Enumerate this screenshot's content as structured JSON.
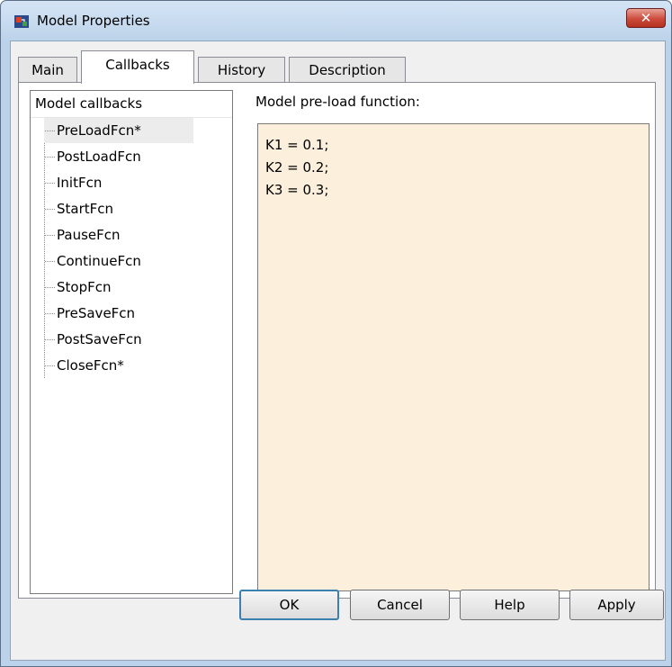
{
  "window": {
    "title": "Model Properties",
    "close_glyph": "✕"
  },
  "tabs": [
    {
      "label": "Main",
      "active": false
    },
    {
      "label": "Callbacks",
      "active": true
    },
    {
      "label": "History",
      "active": false
    },
    {
      "label": "Description",
      "active": false
    }
  ],
  "callbacks": {
    "header": "Model callbacks",
    "items": [
      "PreLoadFcn*",
      "PostLoadFcn",
      "InitFcn",
      "StartFcn",
      "PauseFcn",
      "ContinueFcn",
      "StopFcn",
      "PreSaveFcn",
      "PostSaveFcn",
      "CloseFcn*"
    ],
    "selected_index": 0
  },
  "editor": {
    "label": "Model pre-load function:",
    "lines": [
      "K1 = 0.1;",
      "K2 = 0.2;",
      "K3 = 0.3;"
    ]
  },
  "buttons": {
    "ok": "OK",
    "cancel": "Cancel",
    "help": "Help",
    "apply": "Apply"
  },
  "colors": {
    "editor_background": "#fcf0dd",
    "close_button": "#cc4b3b",
    "default_button_border": "#3c7fb1"
  }
}
